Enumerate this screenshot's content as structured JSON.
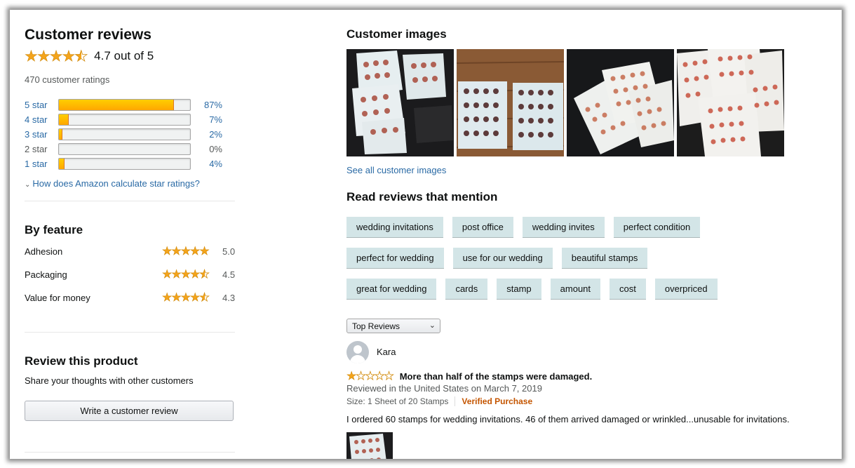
{
  "left": {
    "title": "Customer reviews",
    "overall_rating": 4.7,
    "overall_text": "4.7 out of 5",
    "total_ratings": "470 customer ratings",
    "histogram": [
      {
        "label": "5 star",
        "percent_text": "87%",
        "percent": 87
      },
      {
        "label": "4 star",
        "percent_text": "7%",
        "percent": 7
      },
      {
        "label": "3 star",
        "percent_text": "2%",
        "percent": 2
      },
      {
        "label": "2 star",
        "percent_text": "0%",
        "percent": 0
      },
      {
        "label": "1 star",
        "percent_text": "4%",
        "percent": 4
      }
    ],
    "how_link": "How does Amazon calculate star ratings?",
    "by_feature": {
      "title": "By feature",
      "items": [
        {
          "name": "Adhesion",
          "score": "5.0",
          "rating": 5.0
        },
        {
          "name": "Packaging",
          "score": "4.5",
          "rating": 4.5
        },
        {
          "name": "Value for money",
          "score": "4.3",
          "rating": 4.3
        }
      ]
    },
    "review_product": {
      "title": "Review this product",
      "subtitle": "Share your thoughts with other customers",
      "button": "Write a customer review"
    }
  },
  "right": {
    "customer_images_title": "Customer images",
    "see_all": "See all customer images",
    "mentions_title": "Read reviews that mention",
    "tag_rows": [
      [
        "wedding invitations",
        "post office",
        "wedding invites",
        "perfect condition"
      ],
      [
        "perfect for wedding",
        "use for our wedding",
        "beautiful stamps"
      ],
      [
        "great for wedding",
        "cards",
        "stamp",
        "amount",
        "cost",
        "overpriced"
      ]
    ],
    "sort": {
      "selected": "Top Reviews"
    },
    "review": {
      "reviewer": "Kara",
      "rating": 1,
      "title": "More than half of the stamps were damaged.",
      "date": "Reviewed in the United States on March 7, 2019",
      "size": "Size: 1 Sheet of 20 Stamps",
      "verified": "Verified Purchase",
      "body": "I ordered 60 stamps for wedding invitations. 46 of them arrived damaged or wrinkled...unusable for invitations."
    }
  },
  "colors": {
    "star": "#f4a41b",
    "link": "#2a6aa5",
    "tag_bg": "#d3e5e7",
    "verified": "#c45500"
  }
}
